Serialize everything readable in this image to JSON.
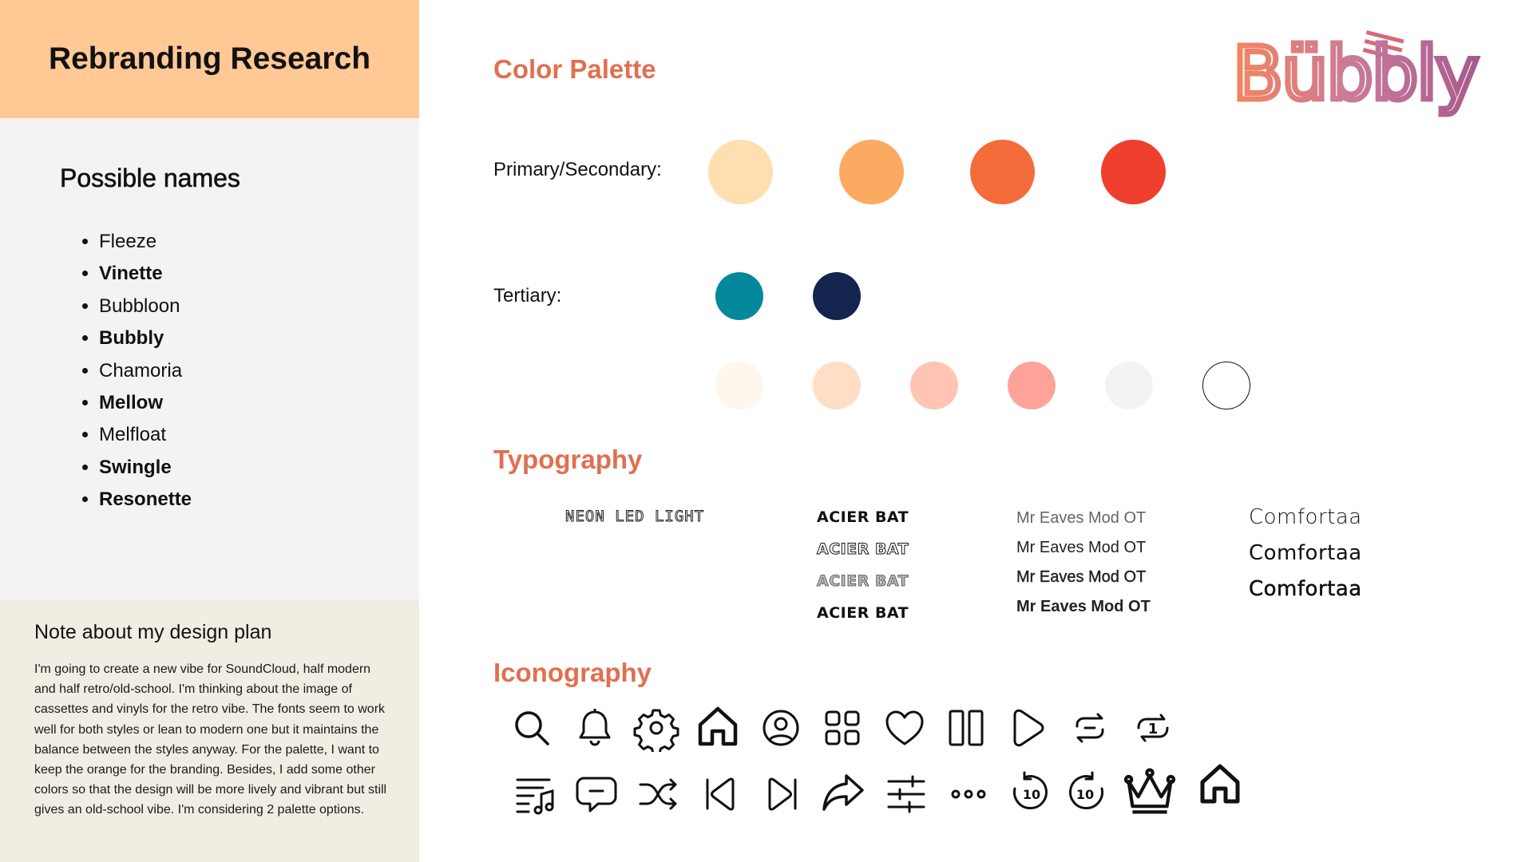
{
  "sidebar": {
    "title": "Rebranding Research",
    "names_heading": "Possible names",
    "names": [
      {
        "label": "Fleeze",
        "bold": false
      },
      {
        "label": "Vinette",
        "bold": true
      },
      {
        "label": "Bubbloon",
        "bold": false
      },
      {
        "label": "Bubbly",
        "bold": true
      },
      {
        "label": "Chamoria",
        "bold": false
      },
      {
        "label": "Mellow",
        "bold": true
      },
      {
        "label": "Melfloat",
        "bold": false
      },
      {
        "label": "Swingle",
        "bold": true
      },
      {
        "label": "Resonette",
        "bold": true
      }
    ],
    "note_heading": "Note about my design plan",
    "note_body": "I'm going to create a new vibe for SoundCloud, half modern and half retro/old-school. I'm thinking about the image of cassettes and vinyls for the retro vibe. The fonts seem to work well for both styles or lean to modern one but it maintains the balance between the styles anyway. For the palette, I want to keep the orange for the branding. Besides, I add some other colors so that the design will be more lively and vibrant but still gives an old-school vibe. I'm considering 2 palette options."
  },
  "logo": {
    "text": "Bübbly",
    "gradient": [
      "#f4845f",
      "#c97a9a",
      "#a85a8c"
    ]
  },
  "palette": {
    "heading": "Color Palette",
    "primary_label": "Primary/Secondary:",
    "primary": [
      "#ffdfb0",
      "#fca962",
      "#f56c3b",
      "#ef3f2e"
    ],
    "tertiary_label": "Tertiary:",
    "tertiary": [
      "#05889b",
      "#13244f"
    ],
    "option2": [
      "#fff6ee",
      "#ffdec6",
      "#ffc4b2",
      "#ffa39a",
      "#f3f3f3",
      "#ffffff"
    ]
  },
  "typography": {
    "heading": "Typography",
    "neon": "NEON LED LIGHT",
    "acier": [
      "ACIER BAT",
      "ACIER BAT",
      "ACIER BAT",
      "ACIER BAT"
    ],
    "eaves": [
      "Mr Eaves Mod OT",
      "Mr Eaves Mod OT",
      "Mr Eaves Mod OT",
      "Mr Eaves Mod OT"
    ],
    "comfortaa": [
      "Comfortaa",
      "Comfortaa",
      "Comfortaa"
    ]
  },
  "iconography": {
    "heading": "Iconography",
    "row1": [
      "search-icon",
      "bell-icon",
      "gear-icon",
      "home-icon",
      "user-circle-icon",
      "grid-icon",
      "heart-icon",
      "columns-icon",
      "play-icon",
      "repeat-icon",
      "repeat-one-icon"
    ],
    "row2": [
      "music-list-icon",
      "chat-icon",
      "shuffle-icon",
      "previous-icon",
      "next-icon",
      "share-icon",
      "sliders-icon",
      "more-icon",
      "rewind-10-icon",
      "forward-10-icon",
      "crown-icon",
      "home-bold-icon"
    ],
    "repeat_one_number": "1",
    "seek_number": "10"
  }
}
